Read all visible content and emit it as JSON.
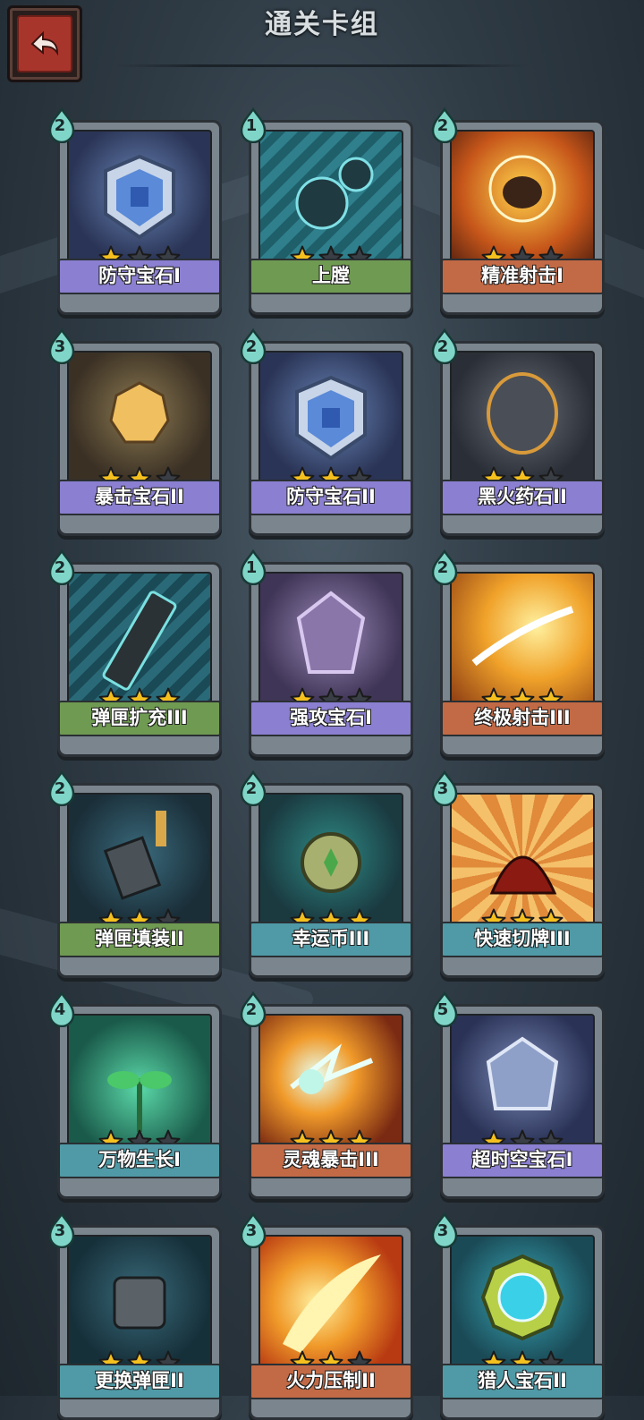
{
  "header": {
    "title": "通关卡组",
    "back_icon": "back-arrow-icon"
  },
  "colors": {
    "star_filled": "#f5c01e",
    "star_empty": "#3a3f46",
    "rarity_purple": "#8a7fd0",
    "rarity_green": "#6f9a52",
    "rarity_orange": "#c26a45",
    "rarity_teal": "#4f9aa6",
    "cost_badge": "#7fd6c8"
  },
  "cards": [
    {
      "name": "防守宝石I",
      "cost": "2",
      "stars": 1,
      "rarity": "purple",
      "art": "shield",
      "icon": "shield-gem-icon"
    },
    {
      "name": "上膛",
      "cost": "1",
      "stars": 1,
      "rarity": "green",
      "art": "cannon",
      "icon": "cannonball-icon"
    },
    {
      "name": "精准射击I",
      "cost": "2",
      "stars": 1,
      "rarity": "orange",
      "art": "aim",
      "icon": "aimed-shot-icon"
    },
    {
      "name": "暴击宝石II",
      "cost": "3",
      "stars": 2,
      "rarity": "purple",
      "art": "crit",
      "icon": "crit-gem-icon"
    },
    {
      "name": "防守宝石II",
      "cost": "2",
      "stars": 2,
      "rarity": "purple",
      "art": "shield",
      "icon": "shield-gem-icon"
    },
    {
      "name": "黑火药石II",
      "cost": "2",
      "stars": 2,
      "rarity": "purple",
      "art": "rock",
      "icon": "gunpowder-stone-icon"
    },
    {
      "name": "弹匣扩充III",
      "cost": "2",
      "stars": 3,
      "rarity": "green",
      "art": "mag",
      "icon": "magazine-icon"
    },
    {
      "name": "强攻宝石I",
      "cost": "1",
      "stars": 1,
      "rarity": "purple",
      "art": "crystal",
      "icon": "attack-gem-icon"
    },
    {
      "name": "终极射击III",
      "cost": "2",
      "stars": 3,
      "rarity": "orange",
      "art": "ult",
      "icon": "ultimate-shot-icon"
    },
    {
      "name": "弹匣填装II",
      "cost": "2",
      "stars": 2,
      "rarity": "green",
      "art": "load",
      "icon": "reload-icon"
    },
    {
      "name": "幸运币III",
      "cost": "2",
      "stars": 3,
      "rarity": "teal",
      "art": "coin",
      "icon": "lucky-coin-icon"
    },
    {
      "name": "快速切牌III",
      "cost": "3",
      "stars": 3,
      "rarity": "teal",
      "art": "shuffle",
      "icon": "card-shuffle-icon"
    },
    {
      "name": "万物生长I",
      "cost": "4",
      "stars": 1,
      "rarity": "teal",
      "art": "grow",
      "icon": "sprout-icon"
    },
    {
      "name": "灵魂暴击III",
      "cost": "2",
      "stars": 3,
      "rarity": "orange",
      "art": "soul",
      "icon": "soul-strike-icon"
    },
    {
      "name": "超时空宝石I",
      "cost": "5",
      "stars": 1,
      "rarity": "purple",
      "art": "time",
      "icon": "time-gem-icon"
    },
    {
      "name": "更换弹匣II",
      "cost": "3",
      "stars": 2,
      "rarity": "teal",
      "art": "swap",
      "icon": "swap-magazine-icon"
    },
    {
      "name": "火力压制II",
      "cost": "3",
      "stars": 2,
      "rarity": "orange",
      "art": "fire",
      "icon": "fire-suppress-icon"
    },
    {
      "name": "猎人宝石II",
      "cost": "3",
      "stars": 2,
      "rarity": "teal",
      "art": "hunter",
      "icon": "hunter-gem-icon"
    }
  ]
}
